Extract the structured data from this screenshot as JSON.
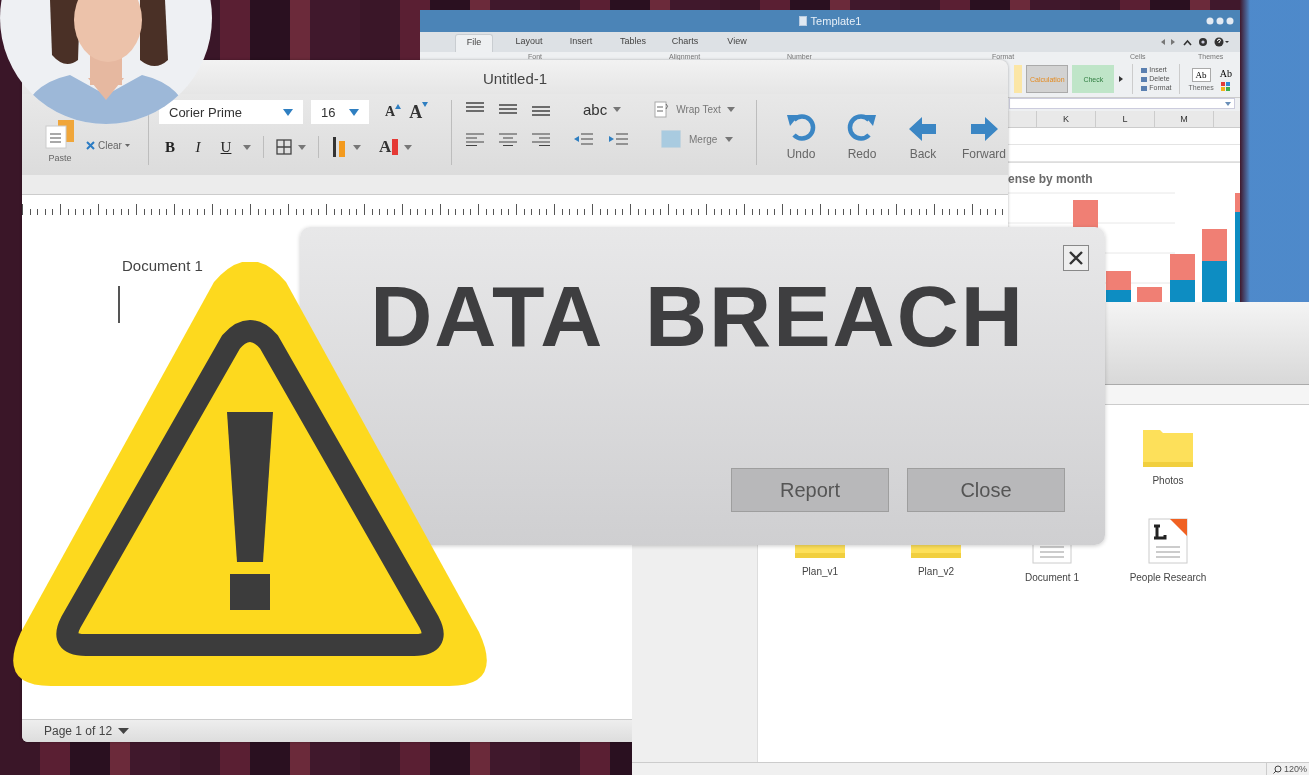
{
  "spreadsheet_window": {
    "title": "Template1",
    "tabs": [
      {
        "label": "File",
        "selected": true
      },
      {
        "label": "Layout",
        "selected": false
      },
      {
        "label": "Insert",
        "selected": false
      },
      {
        "label": "Tables",
        "selected": false
      },
      {
        "label": "Charts",
        "selected": false
      },
      {
        "label": "View",
        "selected": false
      }
    ],
    "group_labels": [
      "Font",
      "Alignment",
      "Number",
      "Format",
      "Cells",
      "Themes"
    ],
    "styles": [
      {
        "label": "Calculation",
        "kind": "calculation"
      },
      {
        "label": "Check",
        "kind": "check"
      }
    ],
    "cells_menu": [
      "Insert",
      "Delete",
      "Format"
    ],
    "themes": {
      "sample": "Ab",
      "label": "Themes",
      "font_sample": "Ab"
    },
    "columns": [
      "K",
      "L",
      "M"
    ],
    "chart_title": "ense by month"
  },
  "editor_window": {
    "title": "Untitled-1",
    "paste": "Paste",
    "clear": "Clear",
    "font": "Corier Prime",
    "size": "16",
    "grow_font": "A",
    "shrink_font": "A",
    "bold": "B",
    "italic": "I",
    "underline": "U",
    "font_color": "A",
    "case": "abc",
    "wrap_text": "Wrap Text",
    "merge": "Merge",
    "nav": [
      {
        "label": "Undo",
        "kind": "undo"
      },
      {
        "label": "Redo",
        "kind": "redo"
      },
      {
        "label": "Back",
        "kind": "back"
      },
      {
        "label": "Forward",
        "kind": "forward"
      }
    ],
    "document_title": "Document 1",
    "page_status": "Page 1 of 12"
  },
  "file_browser": {
    "rows": [
      {
        "items": [
          {
            "label": "Photos",
            "kind": "folder"
          }
        ]
      },
      {
        "items": [
          {
            "label": "Plan_v1",
            "kind": "folder"
          },
          {
            "label": "Plan_v2",
            "kind": "folder"
          },
          {
            "label": "Document 1",
            "kind": "document"
          },
          {
            "label": "People Research",
            "kind": "letter"
          }
        ]
      }
    ],
    "zoom": "120%"
  },
  "dialog": {
    "title": "DATA BREACH",
    "buttons": [
      "Report",
      "Close"
    ]
  }
}
